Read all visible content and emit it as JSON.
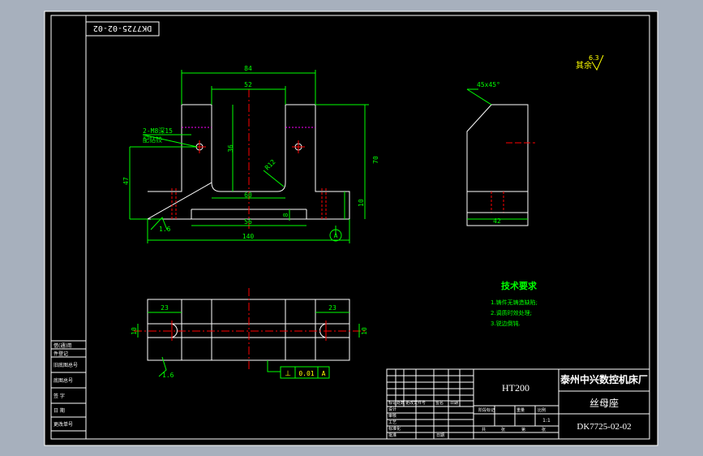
{
  "drawing": {
    "top_stamp": "DK7725-02-02",
    "rough_note": "其余",
    "rough_value": "6.3",
    "chamfer": "45x45°",
    "material": "HT200",
    "company": "泰州中兴数控机床厂",
    "part_name": "丝母座",
    "drawing_no": "DK7725-02-02",
    "scale": "1:1"
  },
  "dims": {
    "d84": "84",
    "d52": "52",
    "d36": "36",
    "d70": "70",
    "d47": "47",
    "d10": "10",
    "d60": "60",
    "d56": "56",
    "d8": "8",
    "d140": "140",
    "r12": "R12",
    "ra16a": "1.6",
    "ra16b": "1.6",
    "datum": "A",
    "hole_note_1": "2-M8深15",
    "hole_note_2": "配钻铰",
    "side_42": "42",
    "plan_23a": "23",
    "plan_23b": "23",
    "plan_10a": "10",
    "plan_10b": "10",
    "tol_symbol": "⊥",
    "tol_value": "0.01",
    "tol_datum": "A"
  },
  "tech": {
    "title": "技术要求",
    "items": [
      "1.铸件无铸造缺陷;",
      "2.调质时效处理;",
      "3.锐边倒钝."
    ]
  },
  "left_strip": [
    "借(通)用",
    "件登记",
    "旧底图总号",
    "底图总号",
    "签 字",
    "日 期",
    "更改单号"
  ],
  "tb_small": [
    "标记",
    "处数",
    "更改文件号",
    "签名",
    "日期",
    "设计",
    "审核",
    "工艺",
    "标准化",
    "批准",
    "日期",
    "阶段标记",
    "重量",
    "比例",
    "共",
    "张",
    "第",
    "张"
  ]
}
